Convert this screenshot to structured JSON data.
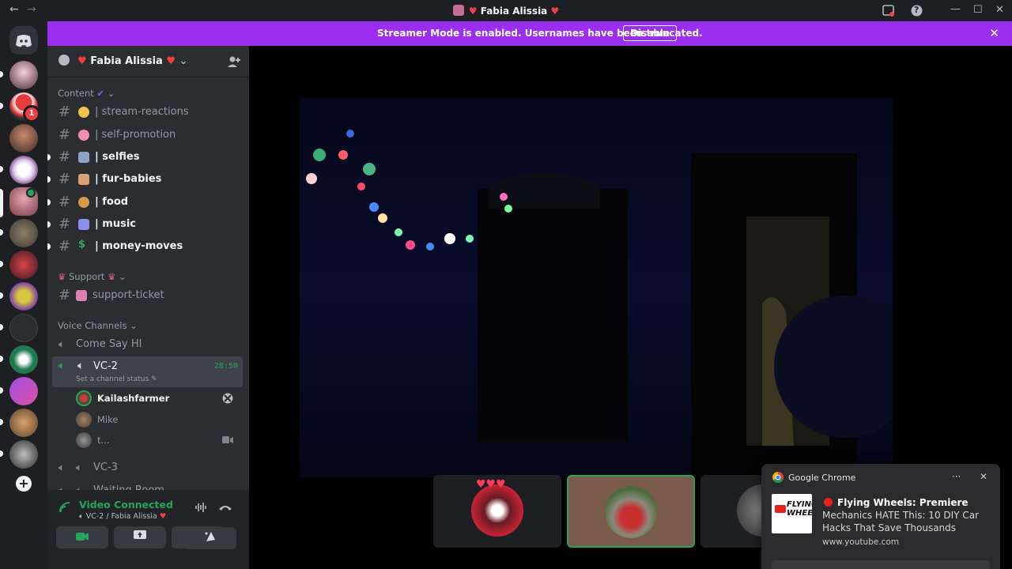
{
  "window": {
    "title": "Fabia Alissia",
    "back": "←",
    "forward": "→",
    "minimize": "—",
    "maximize": "☐",
    "close": "✕",
    "help": "?"
  },
  "banner": {
    "text": "Streamer Mode is enabled. Usernames have been truncated.",
    "button": "Disable",
    "close": "✕"
  },
  "server": {
    "name": "Fabia Alissia"
  },
  "categories": {
    "content": "Content",
    "support": "Support",
    "voice": "Voice Channels"
  },
  "channels": [
    {
      "label": "| stream-reactions",
      "emoji_color": "#f0c24a",
      "unread": false
    },
    {
      "label": "| self-promotion",
      "emoji_color": "#f08fb0",
      "unread": false
    },
    {
      "label": "| selfies",
      "emoji_color": "#8fa3c8",
      "unread": true
    },
    {
      "label": "| fur-babies",
      "emoji_color": "#d9a074",
      "unread": true
    },
    {
      "label": "| food",
      "emoji_color": "#d89a4a",
      "unread": true
    },
    {
      "label": "| music",
      "emoji_color": "#8a8ff0",
      "unread": true
    },
    {
      "label": "| money-moves",
      "emoji_color": "#3ba55c",
      "unread": true
    }
  ],
  "support_channel": {
    "label": "support-ticket",
    "emoji_color": "#e080b0"
  },
  "voice_channels": {
    "come_say_hi": "Come Say HI",
    "vc2": {
      "label": "VC-2",
      "timer": "28:50",
      "status": "Set a channel status"
    },
    "members": [
      {
        "name": "Kailashfarmer",
        "bold": true
      },
      {
        "name": "Mike",
        "bold": false
      },
      {
        "name": "t...",
        "bold": false
      }
    ],
    "vc3": "VC-3",
    "waiting": "Waiting Room"
  },
  "voice_panel": {
    "status": "Video Connected",
    "location": "VC-2 / Fabia Alissia"
  },
  "servers": {
    "badge_count": "1",
    "add": "+"
  },
  "notification": {
    "app": "Google Chrome",
    "menu": "···",
    "close": "✕",
    "title": "Flying Wheels: Premiere",
    "body": "Mechanics HATE This: 10 DIY Car Hacks That Save Thousands",
    "url": "www.youtube.com",
    "logo_text": "FLYING WHEELS"
  },
  "colors": {
    "accent": "#9b2ff0",
    "green": "#23a55a",
    "blurple": "#5865f2"
  }
}
